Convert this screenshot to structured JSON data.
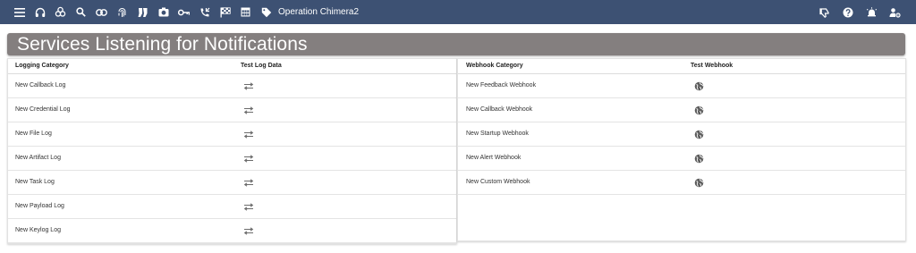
{
  "header": {
    "operation_name": "Operation Chimera2",
    "left_icons": [
      "menu-icon",
      "headphones-icon",
      "biohazard-icon",
      "search-icon",
      "link-icon",
      "fingerprint-icon",
      "socks-icon",
      "camera-icon",
      "key-icon",
      "phone-callback-icon",
      "checkered-flag-icon",
      "table-icon",
      "tag-icon"
    ],
    "right_icons": [
      "thumb-down-icon",
      "help-icon",
      "alert-bell-icon",
      "user-settings-icon"
    ],
    "bg_color": "#3d5173"
  },
  "page_title": "Services Listening for Notifications",
  "logging": {
    "col_category": "Logging Category",
    "col_test": "Test Log Data",
    "rows": [
      {
        "name": "New Callback Log"
      },
      {
        "name": "New Credential Log"
      },
      {
        "name": "New File Log"
      },
      {
        "name": "New Artifact Log"
      },
      {
        "name": "New Task Log"
      },
      {
        "name": "New Payload Log"
      },
      {
        "name": "New Keylog Log"
      }
    ]
  },
  "webhooks": {
    "col_category": "Webhook Category",
    "col_test": "Test Webhook",
    "rows": [
      {
        "name": "New Feedback Webhook"
      },
      {
        "name": "New Callback Webhook"
      },
      {
        "name": "New Startup Webhook"
      },
      {
        "name": "New Alert Webhook"
      },
      {
        "name": "New Custom Webhook"
      }
    ]
  },
  "colors": {
    "title_bar": "#847f7f",
    "icon_gray": "#6b6b6b"
  }
}
